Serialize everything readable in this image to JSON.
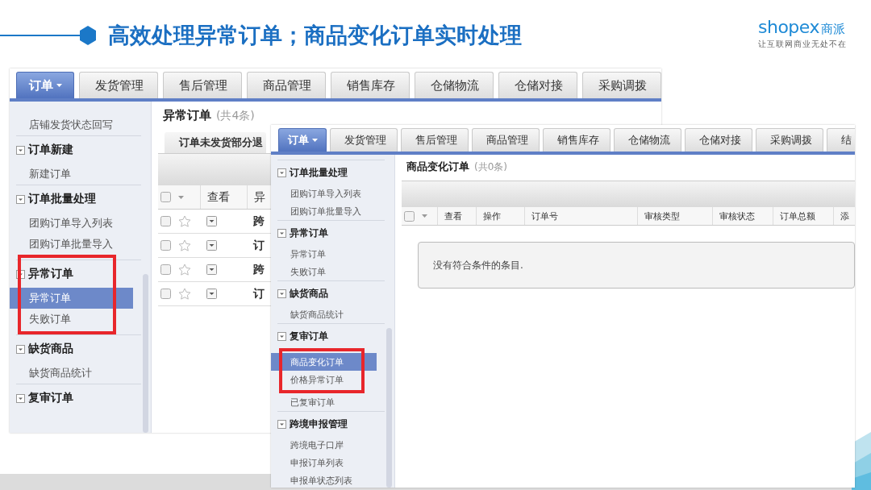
{
  "slide": {
    "title": "高效处理异常订单；商品变化订单实时处理",
    "logo": {
      "wordmark": "shopex",
      "name": "商派",
      "tagline": "让互联网商业无处不在"
    }
  },
  "screens": [
    {
      "tabs": [
        {
          "label": "订单",
          "selected": true,
          "dropdown": true
        },
        {
          "label": "发货管理",
          "selected": false,
          "dropdown": false
        },
        {
          "label": "售后管理",
          "selected": false,
          "dropdown": false
        },
        {
          "label": "商品管理",
          "selected": false,
          "dropdown": false
        },
        {
          "label": "销售库存",
          "selected": false,
          "dropdown": false
        },
        {
          "label": "仓储物流",
          "selected": false,
          "dropdown": false
        },
        {
          "label": "仓储对接",
          "selected": false,
          "dropdown": false
        },
        {
          "label": "采购调拨",
          "selected": false,
          "dropdown": false
        }
      ],
      "sidebar": [
        {
          "kind": "item",
          "label": "店铺发货状态回写",
          "selected": false,
          "highlighted": false
        },
        {
          "kind": "header",
          "label": "订单新建",
          "highlighted": false
        },
        {
          "kind": "item",
          "label": "新建订单",
          "selected": false,
          "highlighted": false
        },
        {
          "kind": "header",
          "label": "订单批量处理",
          "highlighted": false
        },
        {
          "kind": "item",
          "label": "团购订单导入列表",
          "selected": false,
          "highlighted": false
        },
        {
          "kind": "item",
          "label": "团购订单批量导入",
          "selected": false,
          "highlighted": false
        },
        {
          "kind": "header",
          "label": "异常订单",
          "highlighted": true
        },
        {
          "kind": "item",
          "label": "异常订单",
          "selected": true,
          "highlighted": true
        },
        {
          "kind": "item",
          "label": "失败订单",
          "selected": false,
          "highlighted": true
        },
        {
          "kind": "header",
          "label": "缺货商品",
          "highlighted": false
        },
        {
          "kind": "item",
          "label": "缺货商品统计",
          "selected": false,
          "highlighted": false
        },
        {
          "kind": "header",
          "label": "复审订单",
          "highlighted": false
        }
      ],
      "content": {
        "title": "异常订单",
        "count": "(共4条)",
        "subtab": "订单未发货部分退",
        "select_all_checked": false,
        "columns": [
          "查看",
          "异"
        ],
        "rows": [
          {
            "checked": false,
            "starred": false,
            "cells": [
              "跨"
            ]
          },
          {
            "checked": false,
            "starred": false,
            "cells": [
              "订"
            ]
          },
          {
            "checked": false,
            "starred": false,
            "cells": [
              "跨"
            ]
          },
          {
            "checked": false,
            "starred": false,
            "cells": [
              "订"
            ]
          }
        ]
      }
    },
    {
      "tabs": [
        {
          "label": "订单",
          "selected": true,
          "dropdown": true
        },
        {
          "label": "发货管理",
          "selected": false,
          "dropdown": false
        },
        {
          "label": "售后管理",
          "selected": false,
          "dropdown": false
        },
        {
          "label": "商品管理",
          "selected": false,
          "dropdown": false
        },
        {
          "label": "销售库存",
          "selected": false,
          "dropdown": false
        },
        {
          "label": "仓储物流",
          "selected": false,
          "dropdown": false
        },
        {
          "label": "仓储对接",
          "selected": false,
          "dropdown": false
        },
        {
          "label": "采购调拨",
          "selected": false,
          "dropdown": false
        },
        {
          "label": "结",
          "selected": false
        }
      ],
      "sidebar": [
        {
          "kind": "header",
          "label": "订单批量处理",
          "highlighted": false
        },
        {
          "kind": "item",
          "label": "团购订单导入列表",
          "selected": false,
          "highlighted": false
        },
        {
          "kind": "item",
          "label": "团购订单批量导入",
          "selected": false,
          "highlighted": false
        },
        {
          "kind": "header",
          "label": "异常订单",
          "highlighted": false
        },
        {
          "kind": "item",
          "label": "异常订单",
          "selected": false,
          "highlighted": false
        },
        {
          "kind": "item",
          "label": "失败订单",
          "selected": false,
          "highlighted": false
        },
        {
          "kind": "header",
          "label": "缺货商品",
          "highlighted": false
        },
        {
          "kind": "item",
          "label": "缺货商品统计",
          "selected": false,
          "highlighted": false
        },
        {
          "kind": "header",
          "label": "复审订单",
          "highlighted": false
        },
        {
          "kind": "item",
          "label": "商品变化订单",
          "selected": true,
          "highlighted": true
        },
        {
          "kind": "item",
          "label": "价格异常订单",
          "selected": false,
          "highlighted": true
        },
        {
          "kind": "item",
          "label": "已复审订单",
          "selected": false,
          "highlighted": false
        },
        {
          "kind": "header",
          "label": "跨境申报管理",
          "highlighted": false
        },
        {
          "kind": "item",
          "label": "跨境电子口岸",
          "selected": false,
          "highlighted": false
        },
        {
          "kind": "item",
          "label": "申报订单列表",
          "selected": false,
          "highlighted": false
        },
        {
          "kind": "item",
          "label": "申报单状态列表",
          "selected": false,
          "highlighted": false
        }
      ],
      "content": {
        "title": "商品变化订单",
        "count": "(共0条)",
        "select_all_checked": false,
        "columns": [
          "查看",
          "操作",
          "订单号",
          "审核类型",
          "审核状态",
          "订单总额",
          "添"
        ],
        "empty_message": "没有符合条件的条目."
      }
    }
  ]
}
